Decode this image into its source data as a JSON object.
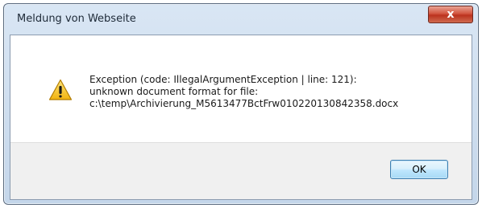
{
  "window": {
    "title": "Meldung von Webseite",
    "close_label": "x"
  },
  "dialog": {
    "icon": "warning-icon",
    "message_lines": [
      "Exception (code: IllegalArgumentException | line: 121):",
      "unknown document format for file:",
      "c:\\temp\\Archivierung_M5613477BctFrw010220130842358.docx"
    ],
    "ok_label": "OK"
  },
  "colors": {
    "frame": "#c4d6ea",
    "close_button": "#c8442e",
    "footer": "#f0f0f0",
    "ok_border": "#3c7fb1",
    "warning_yellow": "#f7c51e"
  }
}
